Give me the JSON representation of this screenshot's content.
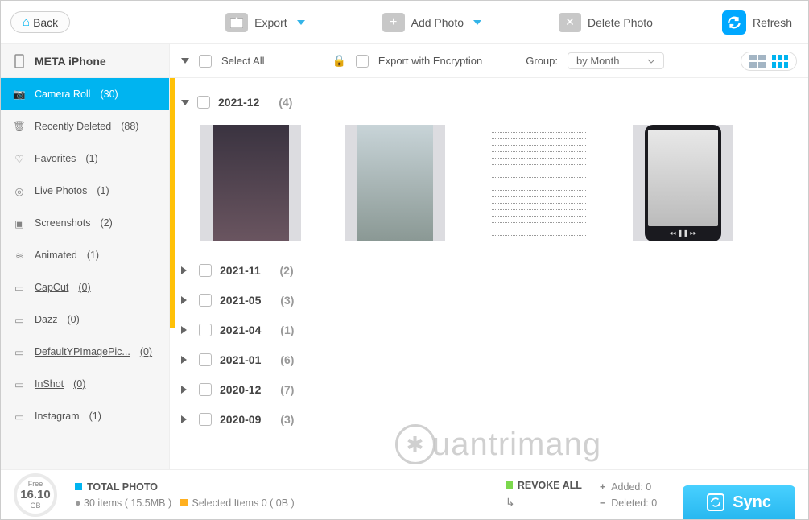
{
  "toolbar": {
    "back": "Back",
    "export": "Export",
    "add_photo": "Add Photo",
    "delete_photo": "Delete Photo",
    "refresh": "Refresh"
  },
  "device": {
    "name": "META iPhone"
  },
  "sidebar": [
    {
      "icon": "camera",
      "label": "Camera Roll",
      "count": "(30)",
      "active": true,
      "underline": false
    },
    {
      "icon": "trash",
      "label": "Recently Deleted",
      "count": "(88)",
      "underline": false
    },
    {
      "icon": "heart",
      "label": "Favorites",
      "count": "(1)",
      "underline": false
    },
    {
      "icon": "live",
      "label": "Live Photos",
      "count": "(1)",
      "underline": false
    },
    {
      "icon": "screenshot",
      "label": "Screenshots",
      "count": "(2)",
      "underline": false
    },
    {
      "icon": "animated",
      "label": "Animated",
      "count": "(1)",
      "underline": false
    },
    {
      "icon": "album",
      "label": "CapCut",
      "count": "(0)",
      "underline": true
    },
    {
      "icon": "album",
      "label": "Dazz",
      "count": "(0)",
      "underline": true
    },
    {
      "icon": "album",
      "label": "DefaultYPImagePic...",
      "count": "(0)",
      "underline": true
    },
    {
      "icon": "album",
      "label": "InShot",
      "count": "(0)",
      "underline": true
    },
    {
      "icon": "album",
      "label": "Instagram",
      "count": "(1)",
      "underline": false
    }
  ],
  "main_head": {
    "select_all": "Select All",
    "export_enc": "Export with Encryption",
    "group_label": "Group:",
    "group_value": "by Month"
  },
  "groups": [
    {
      "label": "2021-12",
      "count": "(4)",
      "expanded": true
    },
    {
      "label": "2021-11",
      "count": "(2)",
      "expanded": false
    },
    {
      "label": "2021-05",
      "count": "(3)",
      "expanded": false
    },
    {
      "label": "2021-04",
      "count": "(1)",
      "expanded": false
    },
    {
      "label": "2021-01",
      "count": "(6)",
      "expanded": false
    },
    {
      "label": "2020-12",
      "count": "(7)",
      "expanded": false
    },
    {
      "label": "2020-09",
      "count": "(3)",
      "expanded": false
    }
  ],
  "watermark": "uantrimang",
  "footer": {
    "storage_label": "Free",
    "storage_value": "16.10",
    "storage_unit": "GB",
    "total_photo": "TOTAL PHOTO",
    "total_items": "30 items ( 15.5MB )",
    "selected": "Selected Items 0 ( 0B )",
    "revoke": "REVOKE ALL",
    "added": "Added: 0",
    "deleted": "Deleted: 0",
    "sync": "Sync",
    "colors": {
      "total": "#00b4f0",
      "selected": "#ffb020",
      "revoke": "#7bd84c"
    }
  }
}
